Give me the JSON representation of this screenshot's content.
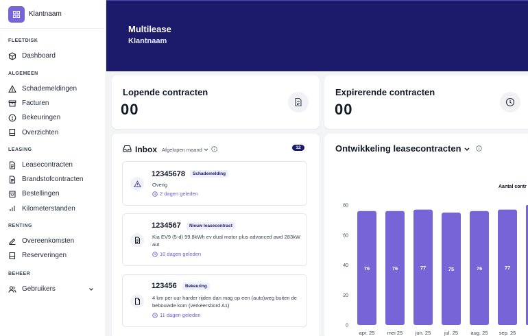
{
  "brand": {
    "name": "Klantnaam",
    "logo_icon": "grid-icon",
    "accent": "#7764d6"
  },
  "sidebar": {
    "sections": [
      {
        "title": "FLEETDISK",
        "items": [
          {
            "label": "Dashboard",
            "icon": "cube-icon"
          }
        ]
      },
      {
        "title": "ALGEMEEN",
        "items": [
          {
            "label": "Schademeldingen",
            "icon": "warning-icon"
          },
          {
            "label": "Facturen",
            "icon": "archive-icon"
          },
          {
            "label": "Bekeuringen",
            "icon": "alert-circle-icon"
          },
          {
            "label": "Overzichten",
            "icon": "book-icon"
          }
        ]
      },
      {
        "title": "LEASING",
        "items": [
          {
            "label": "Leasecontracten",
            "icon": "document-icon"
          },
          {
            "label": "Brandstofcontracten",
            "icon": "document-icon"
          },
          {
            "label": "Bestellingen",
            "icon": "shopping-bag-icon"
          },
          {
            "label": "Kilometerstanden",
            "icon": "bar-chart-icon"
          }
        ]
      },
      {
        "title": "RENTING",
        "items": [
          {
            "label": "Overeenkomsten",
            "icon": "signature-icon"
          },
          {
            "label": "Reserveringen",
            "icon": "book-icon"
          }
        ]
      },
      {
        "title": "BEHEER",
        "items": [
          {
            "label": "Gebruikers",
            "icon": "users-icon"
          }
        ]
      }
    ]
  },
  "header": {
    "title": "Multilease",
    "subtitle": "Klantnaam",
    "bg": "#1c1a6b"
  },
  "kpis": [
    {
      "title": "Lopende contracten",
      "value": "00",
      "icon": "document-icon"
    },
    {
      "title": "Expirerende contracten",
      "value": "00",
      "icon": "clock-icon"
    }
  ],
  "inbox": {
    "title": "Inbox",
    "filter": "Afgelopen maand",
    "count": "12",
    "messages": [
      {
        "id": "12345678",
        "tag": "Schademelding",
        "body": "Overig",
        "time": "2 dagen geleden",
        "icon": "warning-icon"
      },
      {
        "id": "1234567",
        "tag": "Nieuw leasecontract",
        "body": "Kia EV9 (5-d) 99.8kWh ev dual motor plus advanced awd 283kW aut",
        "time": "10 dagen geleden",
        "icon": "document-icon"
      },
      {
        "id": "123456",
        "tag": "Bekeuring",
        "body": "4 km per uur harder rijden dan mag op een (auto)weg buiten de bebouwde kom (verkeersbord A1)",
        "time": "11 dagen geleden",
        "icon": "file-icon"
      }
    ]
  },
  "chart_data": {
    "type": "bar",
    "title": "Ontwikkeling leasecontracten",
    "legend_label": "Aantal contr",
    "categories": [
      "apr. 25",
      "mei 25",
      "jun. 25",
      "jul. 25",
      "aug. 25",
      "sep. 25"
    ],
    "values": [
      76,
      76,
      77,
      75,
      76,
      77
    ],
    "ylim": [
      0,
      80
    ],
    "yticks": [
      0,
      20,
      40,
      60,
      80
    ],
    "bar_color": "#7764d6",
    "grid": false,
    "legend_position": "top-right"
  }
}
